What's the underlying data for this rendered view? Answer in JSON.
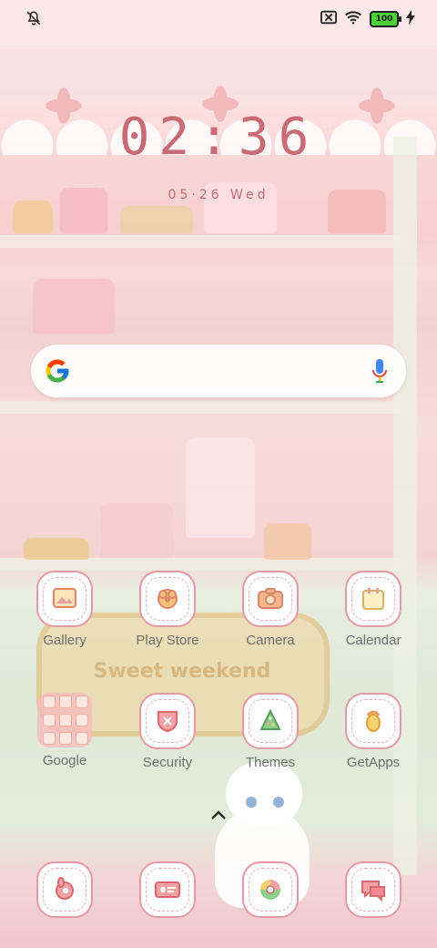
{
  "status_bar": {
    "left_icon": "notifications-off-icon",
    "right_icons": [
      "sim-off-icon",
      "wifi-icon",
      "battery-icon",
      "charging-icon"
    ],
    "battery_level": "100"
  },
  "lockscreen_widget": {
    "time": "02:36",
    "date": "05·26 Wed"
  },
  "search_bar": {
    "left_icon": "google-icon",
    "right_icon": "microphone-icon"
  },
  "apps_row1": [
    {
      "label": "Gallery",
      "icon": "gallery-icon"
    },
    {
      "label": "Play Store",
      "icon": "play-store-icon"
    },
    {
      "label": "Camera",
      "icon": "camera-icon"
    },
    {
      "label": "Calendar",
      "icon": "calendar-icon"
    }
  ],
  "apps_row2": [
    {
      "label": "Google",
      "icon": "google-folder-icon"
    },
    {
      "label": "Security",
      "icon": "security-icon"
    },
    {
      "label": "Themes",
      "icon": "themes-icon"
    },
    {
      "label": "GetApps",
      "icon": "getapps-icon"
    }
  ],
  "dock": [
    {
      "icon": "phone-icon"
    },
    {
      "icon": "contacts-icon"
    },
    {
      "icon": "browser-icon"
    },
    {
      "icon": "messages-icon"
    }
  ],
  "wallpaper": {
    "sign_text": "Sweet weekend"
  },
  "colors": {
    "clock": "#c96a74",
    "icon_border": "#e59aa3",
    "label": "#6f6f6f"
  }
}
